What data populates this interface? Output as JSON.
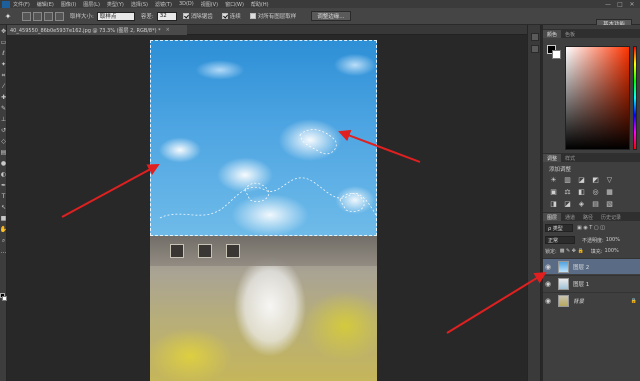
{
  "menubar": {
    "items": [
      "文件(F)",
      "编辑(E)",
      "图像(I)",
      "图层(L)",
      "类型(Y)",
      "选择(S)",
      "滤镜(T)",
      "3D(D)",
      "视图(V)",
      "窗口(W)",
      "帮助(H)"
    ],
    "controls": [
      "—",
      "□",
      "✕"
    ]
  },
  "options": {
    "brush_size_label": "取样大小:",
    "sample_value": "取样点",
    "tolerance_label": "容差:",
    "tolerance_value": "32",
    "antialias_label": "消除锯齿",
    "antialias_checked": true,
    "contiguous_label": "连续",
    "contiguous_checked": true,
    "all_layers_label": "对所有图层取样",
    "all_layers_checked": false,
    "refine_edge_label": "调整边缘...",
    "workspace_label": "基本功能"
  },
  "document": {
    "tab_title": "40_459550_86b0e5937e162.jpg @ 73.3% (图层 2, RGB/8*) *",
    "close_glyph": "×"
  },
  "panels": {
    "color_tabs": [
      "颜色",
      "色板"
    ],
    "adjust_tabs": [
      "调整",
      "样式"
    ],
    "adjust_title": "添加调整",
    "adjust_icons": [
      "☀",
      "▥",
      "◪",
      "◩",
      "▽",
      "",
      "▣",
      "⚖",
      "◧",
      "◎",
      "▦",
      "",
      "◨",
      "◪",
      "◈",
      "▤",
      "▧",
      ""
    ],
    "layers_tabs": [
      "图层",
      "通道",
      "路径",
      "历史记录"
    ],
    "kind_label": "ρ 类型",
    "blend_mode": "正常",
    "opacity_label": "不透明度:",
    "opacity_value": "100%",
    "lock_label": "锁定:",
    "fill_label": "填充:",
    "fill_value": "100%",
    "layers": [
      {
        "name": "图层 2",
        "selected": true,
        "italic": false,
        "locked": false
      },
      {
        "name": "图层 1",
        "selected": false,
        "italic": false,
        "locked": false
      },
      {
        "name": "背景",
        "selected": false,
        "italic": true,
        "locked": true
      }
    ]
  },
  "colors": {
    "accent_arrow": "#e02020",
    "selected_layer": "#5a6c85"
  }
}
